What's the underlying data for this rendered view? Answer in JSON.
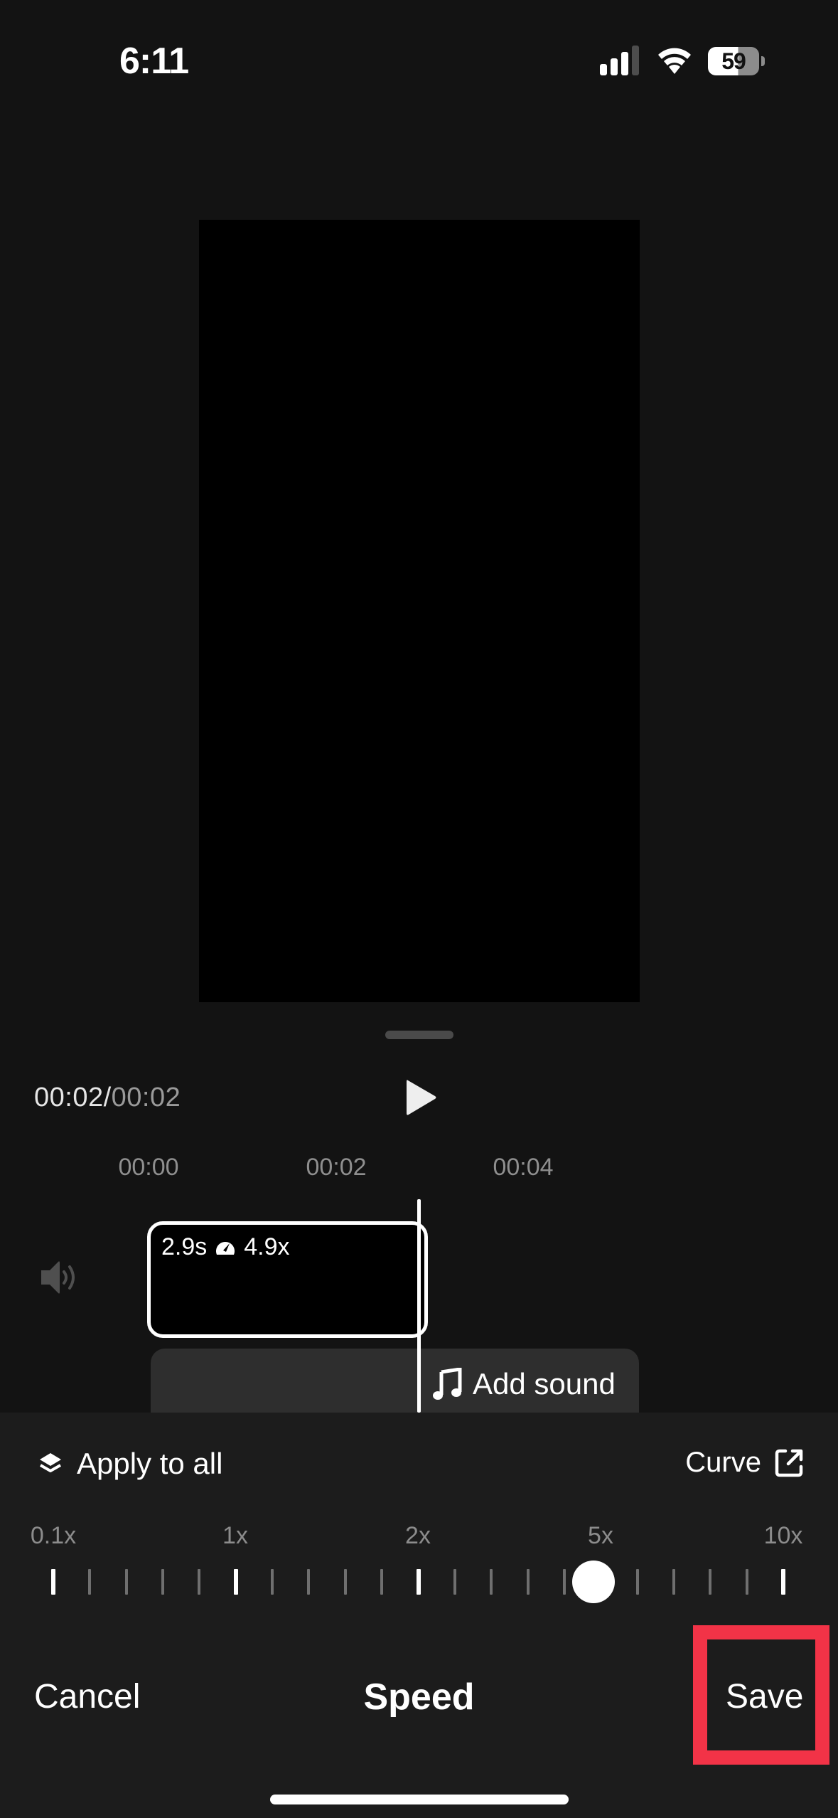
{
  "status_bar": {
    "time": "6:11",
    "battery_percent": "59",
    "battery_level": 0.59,
    "signal_bars_active": 3,
    "signal_bars_total": 4,
    "icons": [
      "cellular-signal-icon",
      "wifi-icon",
      "battery-icon"
    ]
  },
  "player": {
    "current_time": "00:02",
    "separator": "/",
    "total_time": "00:02",
    "play_icon": "play-icon"
  },
  "timeline": {
    "ruler_labels": [
      "00:00",
      "00:02",
      "00:04"
    ],
    "volume_icon": "speaker-icon",
    "clip": {
      "duration": "2.9s",
      "speed_icon": "speedometer-icon",
      "speed": "4.9x"
    },
    "add_sound": {
      "icon": "music-note-icon",
      "label": "Add sound"
    }
  },
  "speed_panel": {
    "apply_to_all": {
      "icon": "layers-icon",
      "label": "Apply to all"
    },
    "curve": {
      "label": "Curve",
      "icon": "external-link-icon"
    },
    "slider": {
      "labels": [
        "0.1x",
        "1x",
        "2x",
        "5x",
        "10x"
      ],
      "tick_count": 21,
      "major_every": 5,
      "value": "4.9x",
      "position_fraction": 0.74
    },
    "cancel_label": "Cancel",
    "title": "Speed",
    "save_label": "Save",
    "highlight_color": "#f23347"
  },
  "colors": {
    "background": "#131313",
    "panel": "#1c1c1c",
    "sound_track": "#2e2e2e",
    "accent_highlight": "#f23347"
  }
}
